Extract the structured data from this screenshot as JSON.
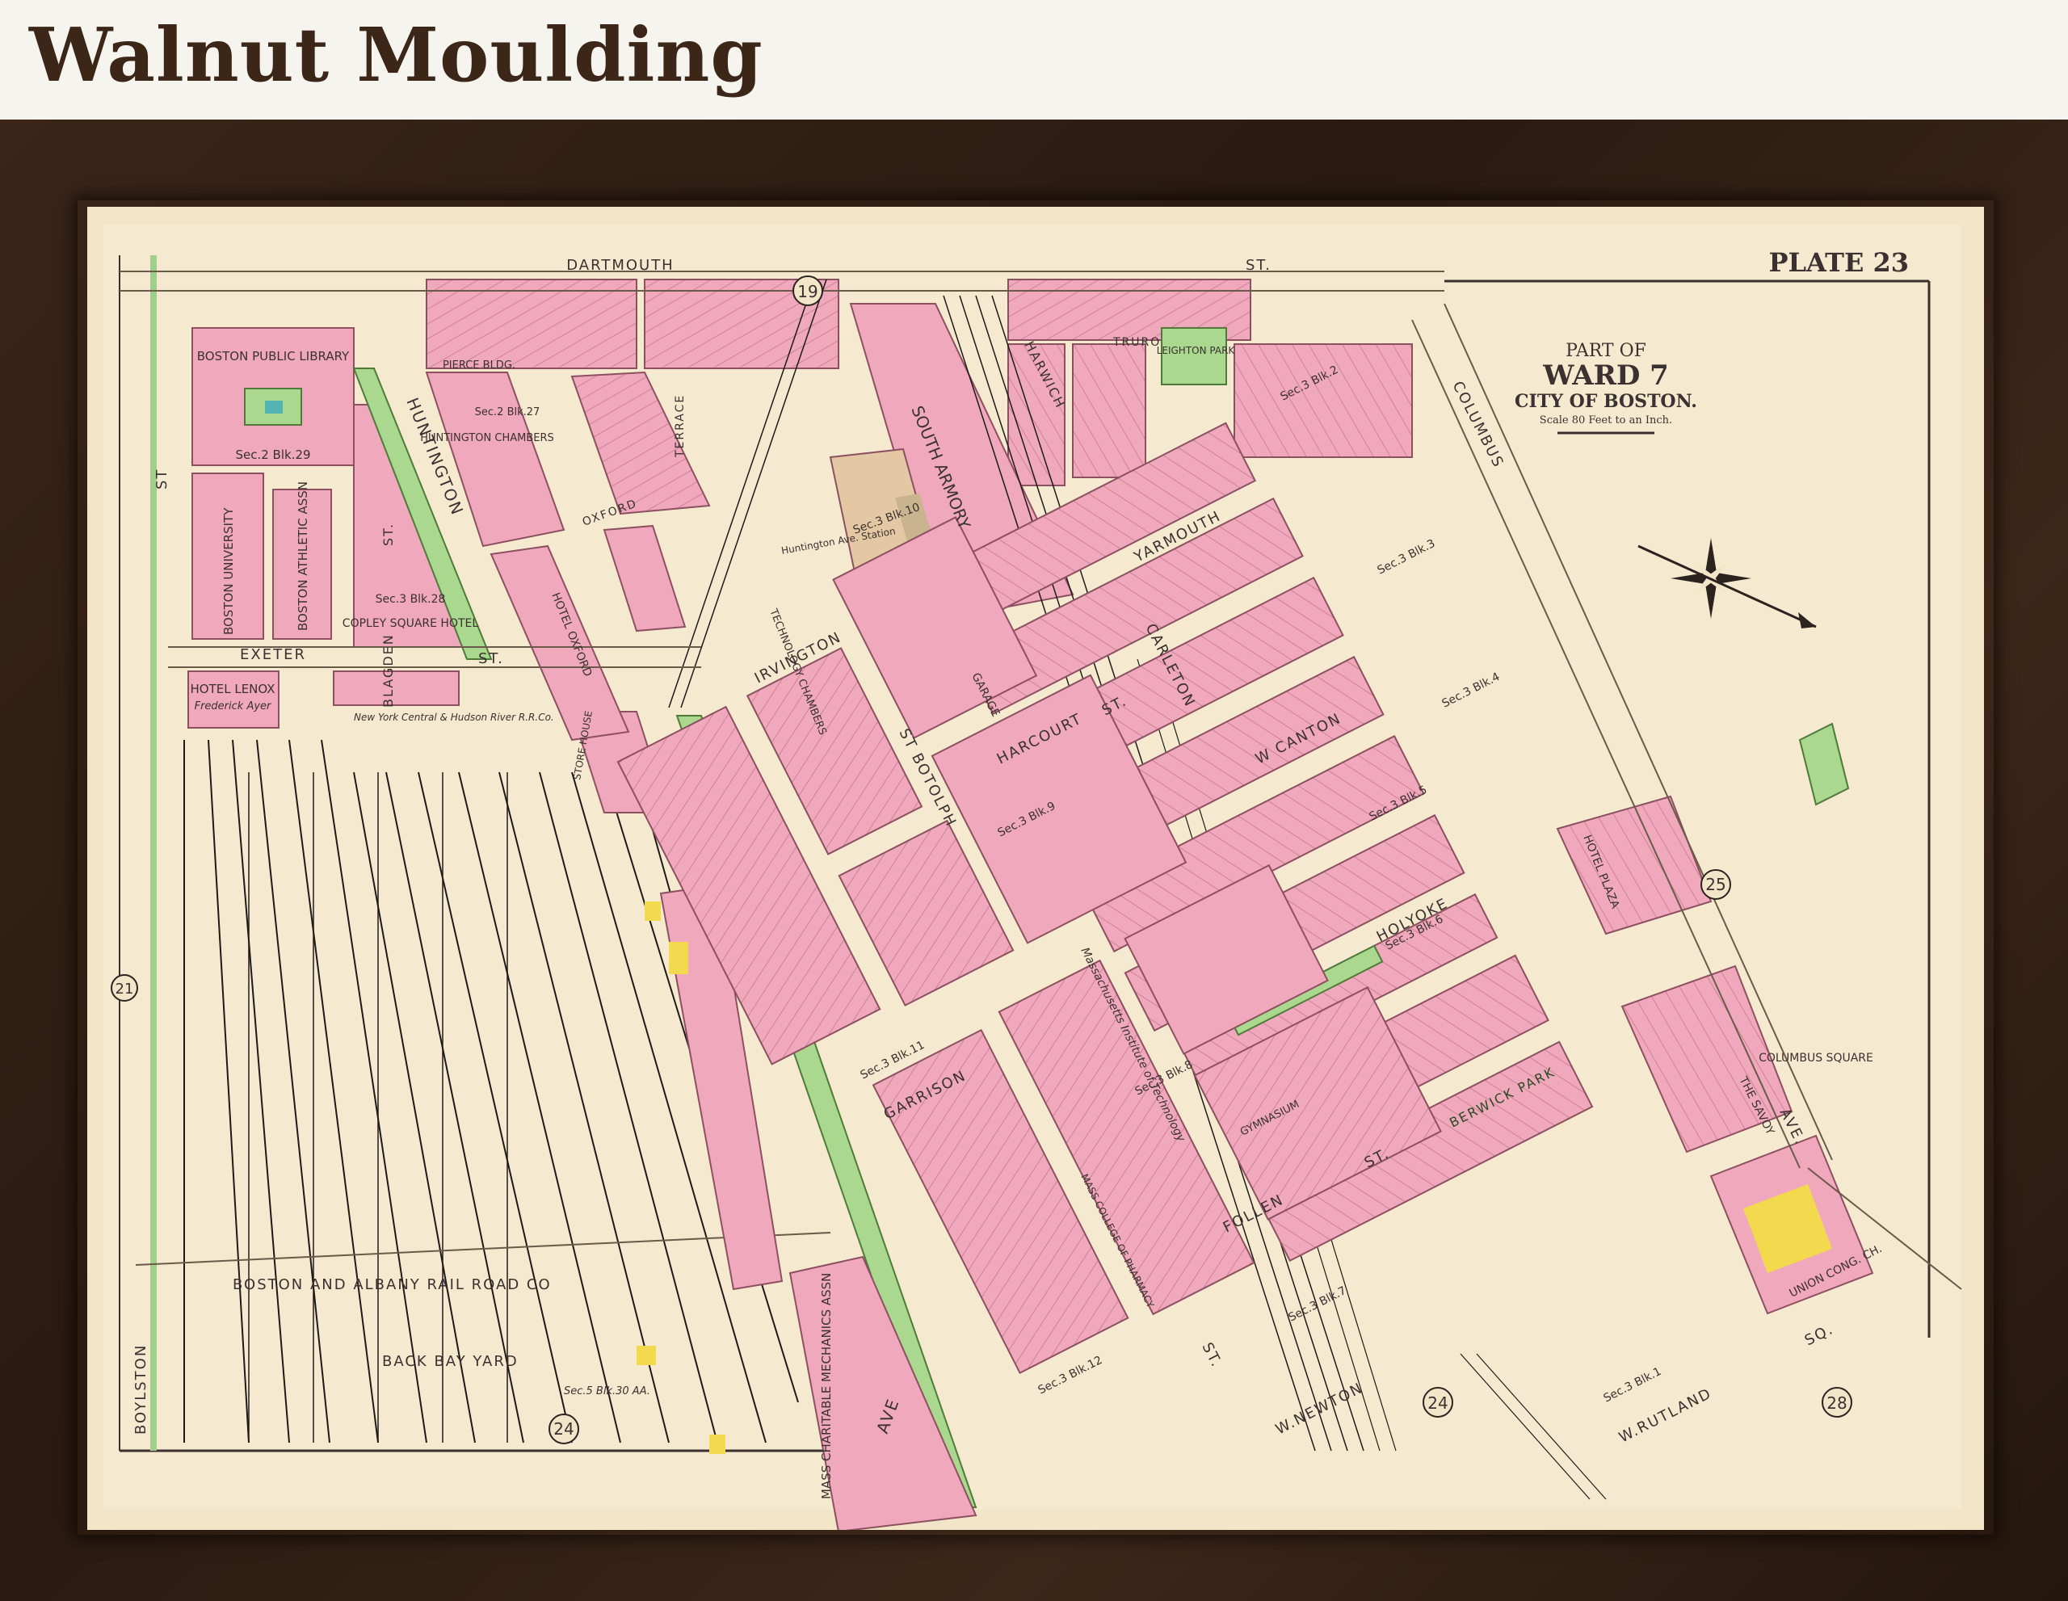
{
  "header": {
    "title": "Walnut Moulding"
  },
  "map": {
    "plate": "PLATE 23",
    "cartouche": {
      "line1": "PART OF",
      "line2": "WARD 7",
      "line3": "CITY OF BOSTON.",
      "scale": "Scale 80 Feet to an Inch."
    },
    "streets": {
      "dartmouth": "DARTMOUTH",
      "st_top": "ST.",
      "huntington": "HUNTINGTON",
      "exeter": "EXETER",
      "exeter_st": "ST.",
      "boylston": "BOYLSTON",
      "irvington": "IRVINGTON",
      "st_botolph": "ST BOTOLPH",
      "harcourt": "HARCOURT",
      "harcourt_st": "ST.",
      "garrison": "GARRISON",
      "yarmouth": "YARMOUTH",
      "carleton": "CARLETON",
      "w_canton": "W CANTON",
      "holyoke": "HOLYOKE",
      "follen": "FOLLEN",
      "follen_st": "ST.",
      "w_newton": "W.NEWTON",
      "w_rutland": "W.RUTLAND",
      "rutland_sq": "SQ.",
      "columbus": "COLUMBUS",
      "columbus_ave": "AVE.",
      "harwich": "HARWICH",
      "truro": "TRURO",
      "newton_st": "ST.",
      "huntington_ave": "AVE",
      "berwick_park": "BERWICK      PARK",
      "blagden": "BLAGDEN",
      "blagden_st": "ST.",
      "terrace": "TERRACE",
      "oxford": "OXFORD",
      "st_left": "ST"
    },
    "places": {
      "boston_public_library": "BOSTON PUBLIC LIBRARY",
      "sec2blk29": "Sec.2 Blk.29",
      "boston_university": "BOSTON UNIVERSITY",
      "boston_athletic": "BOSTON ATHLETIC ASSN",
      "copley_square_hotel": "COPLEY SQUARE HOTEL",
      "sec3blk28": "Sec.3 Blk.28",
      "huntington_chambers": "HUNTINGTON CHAMBERS",
      "sec2blk27": "Sec.2 Blk.27",
      "hotel_oxford": "HOTEL OXFORD",
      "south_armory": "SOUTH ARMORY",
      "sec3blk10": "Sec.3 Blk.10",
      "technology_chambers": "TECHNOLOGY CHAMBERS",
      "hotel_lenox": "HOTEL LENOX",
      "hotel_lenox_owner": "Frederick Ayer",
      "ny_central": "New York Central & Hudson River R.R.Co.",
      "boston_albany": "BOSTON    AND    ALBANY    RAIL  ROAD  CO",
      "back_bay_yard": "BACK    BAY    YARD",
      "sec5blk30aa": "Sec.5 Blk.30 AA.",
      "mass_charitable": "MASS CHARITABLE MECHANICS ASSN",
      "garage": "GARAGE",
      "sec3blk9": "Sec.3 Blk.9",
      "mass_institute": "Massachusetts Institute of Technology",
      "gymnasium": "GYMNASIUM",
      "sec3blk8": "Sec.3 Blk.8",
      "mass_college_pharmacy": "MASS COLLEGE OF PHARMACY",
      "sec3blk11": "Sec.3 Blk.11",
      "sec3blk12": "Sec.3 Blk.12",
      "sec3blk7": "Sec.3 Blk.7",
      "sec3blk6": "Sec.3 Blk.6",
      "sec3blk5": "Sec.3 Blk.5",
      "sec3blk4": "Sec.3 Blk.4",
      "sec3blk3": "Sec.3 Blk.3",
      "sec3blk2": "Sec.3 Blk.2",
      "sec3blk1": "Sec.3 Blk.1",
      "leighton_park": "LEIGHTON PARK",
      "hotel_plaza": "HOTEL PLAZA",
      "the_savoy": "THE SAVOY",
      "union_cong": "UNION CONG. CH.",
      "columbus_square": "COLUMBUS SQUARE",
      "store_house": "STORE HOUSE",
      "pierce_bldg": "PIERCE BLDG.",
      "huntington_station": "Huntington Ave. Station"
    },
    "plate_numbers": {
      "n19": "19",
      "n21": "21",
      "n24a": "24",
      "n24b": "24",
      "n25": "25",
      "n28": "28"
    },
    "colors": {
      "paper": "#f3e6c8",
      "building": "#f0a8bc",
      "building_dark": "#e58aa4",
      "street_line": "#6b5a4a",
      "park": "#a9d88e",
      "yellow_lot": "#f2d94e",
      "frame": "#2e1d12"
    }
  }
}
